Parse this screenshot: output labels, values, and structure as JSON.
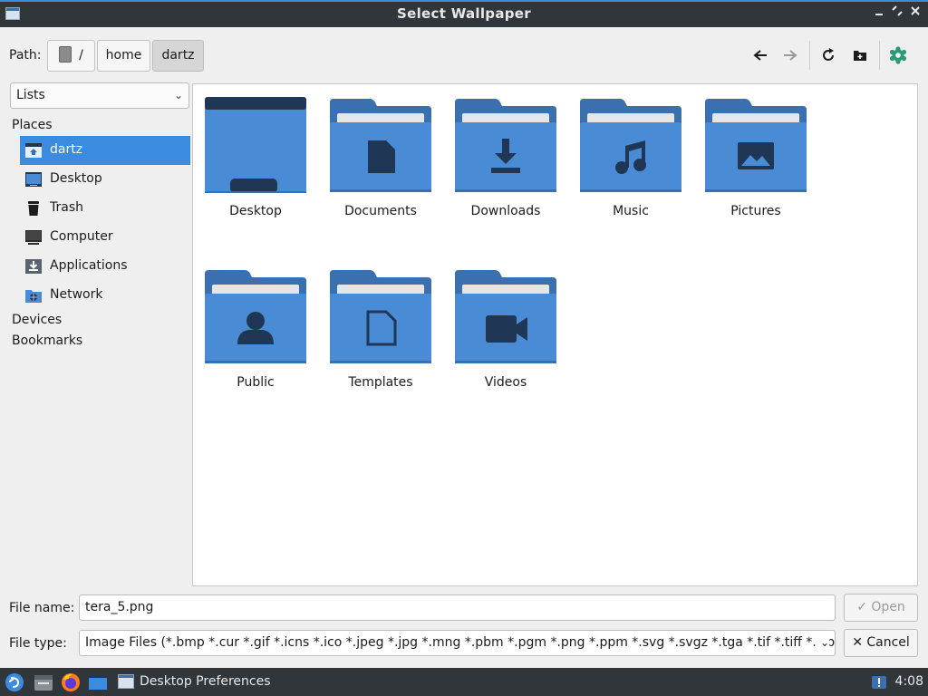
{
  "window": {
    "title": "Select Wallpaper"
  },
  "path": {
    "label": "Path:",
    "crumbs": [
      "/",
      "home",
      "dartz"
    ]
  },
  "sidebar": {
    "view_mode": "Lists",
    "places_header": "Places",
    "places": [
      {
        "label": "dartz",
        "icon": "home-folder-icon"
      },
      {
        "label": "Desktop",
        "icon": "desktop-icon"
      },
      {
        "label": "Trash",
        "icon": "trash-icon"
      },
      {
        "label": "Computer",
        "icon": "computer-icon"
      },
      {
        "label": "Applications",
        "icon": "applications-icon"
      },
      {
        "label": "Network",
        "icon": "network-icon"
      }
    ],
    "devices_header": "Devices",
    "bookmarks_header": "Bookmarks"
  },
  "files": [
    {
      "name": "Desktop",
      "icon": "desktop-folder-icon"
    },
    {
      "name": "Documents",
      "icon": "documents-folder-icon"
    },
    {
      "name": "Downloads",
      "icon": "downloads-folder-icon"
    },
    {
      "name": "Music",
      "icon": "music-folder-icon"
    },
    {
      "name": "Pictures",
      "icon": "pictures-folder-icon"
    },
    {
      "name": "Public",
      "icon": "public-folder-icon"
    },
    {
      "name": "Templates",
      "icon": "templates-folder-icon"
    },
    {
      "name": "Videos",
      "icon": "videos-folder-icon"
    }
  ],
  "bottom": {
    "file_name_label": "File name:",
    "file_name_value": "tera_5.png",
    "file_type_label": "File type:",
    "file_type_value": "Image Files (*.bmp *.cur *.gif *.icns *.ico *.jpeg *.jpg *.mng *.pbm *.pgm *.png *.ppm *.svg *.svgz *.tga *.tif *.tiff *.wbmp",
    "open_label": "Open",
    "cancel_label": "Cancel"
  },
  "taskbar": {
    "task_title": "Desktop Preferences",
    "clock": "4:08"
  },
  "colors": {
    "accent": "#3b8ce0",
    "folder": "#4a8bd6",
    "folder_dark": "#1f3655",
    "bar": "#31363b"
  }
}
